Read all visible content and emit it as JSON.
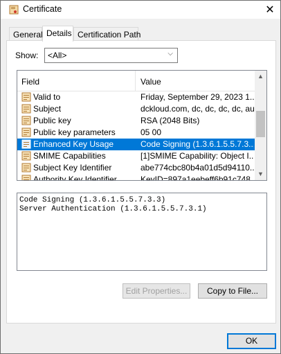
{
  "window": {
    "title": "Certificate",
    "close_glyph": "✕"
  },
  "tabs": [
    {
      "label": "General",
      "active": false
    },
    {
      "label": "Details",
      "active": true
    },
    {
      "label": "Certification Path",
      "active": false
    }
  ],
  "show": {
    "label": "Show:",
    "selected": "<All>"
  },
  "list": {
    "columns": {
      "field": "Field",
      "value": "Value"
    },
    "rows": [
      {
        "field": "Valid to",
        "value": "Friday, September 29, 2023 1...",
        "selected": false
      },
      {
        "field": "Subject",
        "value": "dckloud.com, dc, dc, dc, dc, au",
        "selected": false
      },
      {
        "field": "Public key",
        "value": "RSA (2048 Bits)",
        "selected": false
      },
      {
        "field": "Public key parameters",
        "value": "05 00",
        "selected": false
      },
      {
        "field": "Enhanced Key Usage",
        "value": "Code Signing (1.3.6.1.5.5.7.3....",
        "selected": true
      },
      {
        "field": "SMIME Capabilities",
        "value": "[1]SMIME Capability: Object I...",
        "selected": false
      },
      {
        "field": "Subject Key Identifier",
        "value": "abe774cbc80b4a01d5d94110...",
        "selected": false
      },
      {
        "field": "Authority Key Identifier",
        "value": "KeyID=897a1eebeff6b91c748...",
        "selected": false
      }
    ]
  },
  "detail": {
    "lines": [
      "Code Signing (1.3.6.1.5.5.7.3.3)",
      "Server Authentication (1.3.6.1.5.5.7.3.1)"
    ]
  },
  "buttons": {
    "edit_properties": "Edit Properties...",
    "copy_to_file": "Copy to File...",
    "ok": "OK"
  },
  "colors": {
    "selection": "#0078d7",
    "window_bg": "#f0f0f0",
    "focus_border": "#0078d7"
  },
  "icons": {
    "title": "certificate-icon",
    "row": "cert-field-icon",
    "row_selected": "cert-field-icon-selected",
    "dropdown": "chevron-down-icon",
    "scroll_up": "scroll-up-arrow-icon",
    "scroll_down": "scroll-down-arrow-icon"
  }
}
